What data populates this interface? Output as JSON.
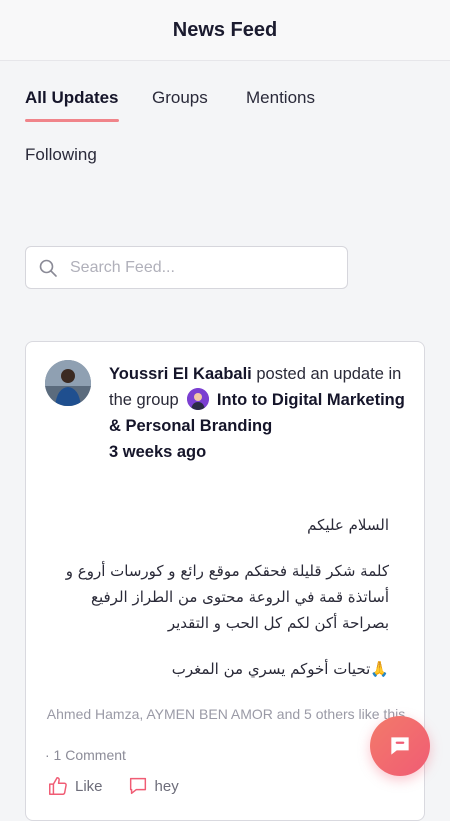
{
  "header": {
    "title": "News Feed"
  },
  "tabs": [
    {
      "label": "All Updates",
      "active": true
    },
    {
      "label": "Groups",
      "active": false
    },
    {
      "label": "Mentions",
      "active": false
    },
    {
      "label": "Following",
      "active": false
    }
  ],
  "search": {
    "placeholder": "Search Feed..."
  },
  "post": {
    "author": "Youssri El Kaabali",
    "action_text": "posted an update in the group",
    "group": "Into to Digital Marketing & Personal Branding",
    "time": "3 weeks ago",
    "body": [
      "السلام عليكم",
      "كلمة شكر قليلة فحقكم موقع رائع و كورسات أروع و أساتذة قمة في الروعة محتوى من الطراز الرفيع بصراحة أكن لكم كل الحب و التقدير",
      "🙏تحيات أخوكم يسري من المغرب"
    ],
    "likes_text": "Ahmed Hamza, AYMEN BEN AMOR and 5 others like this",
    "comments_text": "· 1 Comment",
    "like_label": "Like",
    "comment_label": "hey"
  },
  "colors": {
    "accent": "#f0848a",
    "fab": "#f05c74",
    "group_badge": "#7b3fd1"
  }
}
